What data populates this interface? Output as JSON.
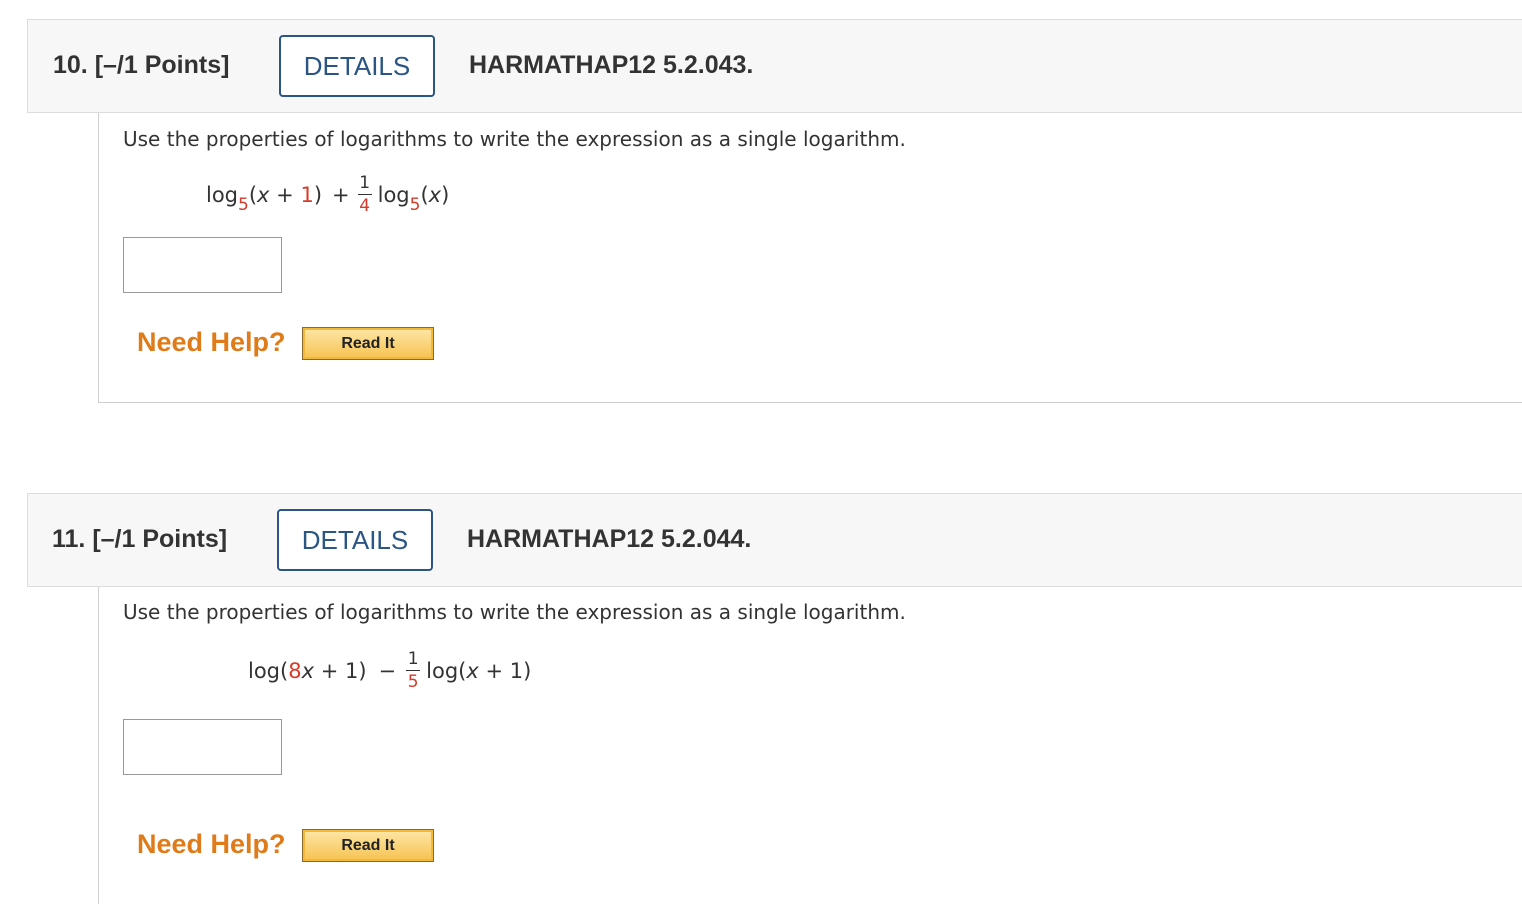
{
  "questions": [
    {
      "number_label": "10. [–/1 Points]",
      "details_label": "DETAILS",
      "code": "HARMATHAP12 5.2.043.",
      "prompt": "Use the properties of logarithms to write the expression as a single logarithm.",
      "expression": {
        "t1_log": "log",
        "t1_base": "5",
        "t1_open": "(",
        "t1_var": "x",
        "t1_plus": " + ",
        "t1_const": "1",
        "t1_close": ")",
        "op": "+",
        "frac_num": "1",
        "frac_den": "4",
        "t2_log": "log",
        "t2_base": "5",
        "t2_open": "(",
        "t2_var": "x",
        "t2_close": ")"
      },
      "answer_value": "",
      "need_help": "Need Help?",
      "read_it": "Read It"
    },
    {
      "number_label": "11. [–/1 Points]",
      "details_label": "DETAILS",
      "code": "HARMATHAP12 5.2.044.",
      "prompt": "Use the properties of logarithms to write the expression as a single logarithm.",
      "expression": {
        "t1_log": "log(",
        "t1_coef": "8",
        "t1_var": "x",
        "t1_rest": " + 1)",
        "op": "−",
        "frac_num": "1",
        "frac_den": "5",
        "t2_log": "log(",
        "t2_var": "x",
        "t2_rest": " + 1)"
      },
      "answer_value": "",
      "need_help": "Need Help?",
      "read_it": "Read It"
    }
  ],
  "colors": {
    "header_bg": "#f7f7f7",
    "details_blue": "#2a5584",
    "highlight_red": "#d63a2a",
    "help_orange": "#e07b1a",
    "button_gold": "#f7c24e"
  }
}
